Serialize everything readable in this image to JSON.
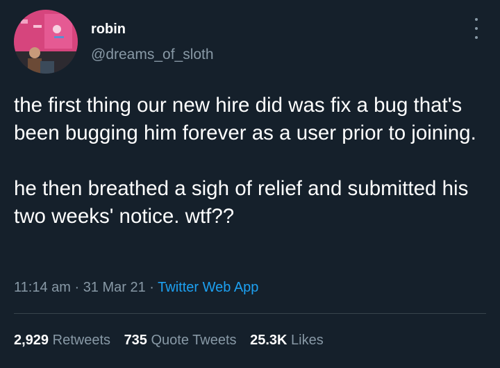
{
  "colors": {
    "background": "#15202b",
    "primary_text": "#ffffff",
    "secondary_text": "#8899a6",
    "link": "#1da1f2",
    "divider": "#38444d"
  },
  "author": {
    "name": "robin",
    "handle": "@dreams_of_sloth"
  },
  "tweet": {
    "paragraph1": "the first thing our new hire did was fix a bug that's been bugging him forever as a user prior to joining.",
    "paragraph2": "he then breathed a sigh of relief and submitted his two weeks' notice. wtf??"
  },
  "meta": {
    "time": "11:14 am",
    "sep1": " · ",
    "date": "31 Mar 21",
    "sep2": " · ",
    "source": "Twitter Web App"
  },
  "stats": {
    "retweets_count": "2,929",
    "retweets_label": "Retweets",
    "quotes_count": "735",
    "quotes_label": "Quote Tweets",
    "likes_count": "25.3K",
    "likes_label": "Likes"
  }
}
